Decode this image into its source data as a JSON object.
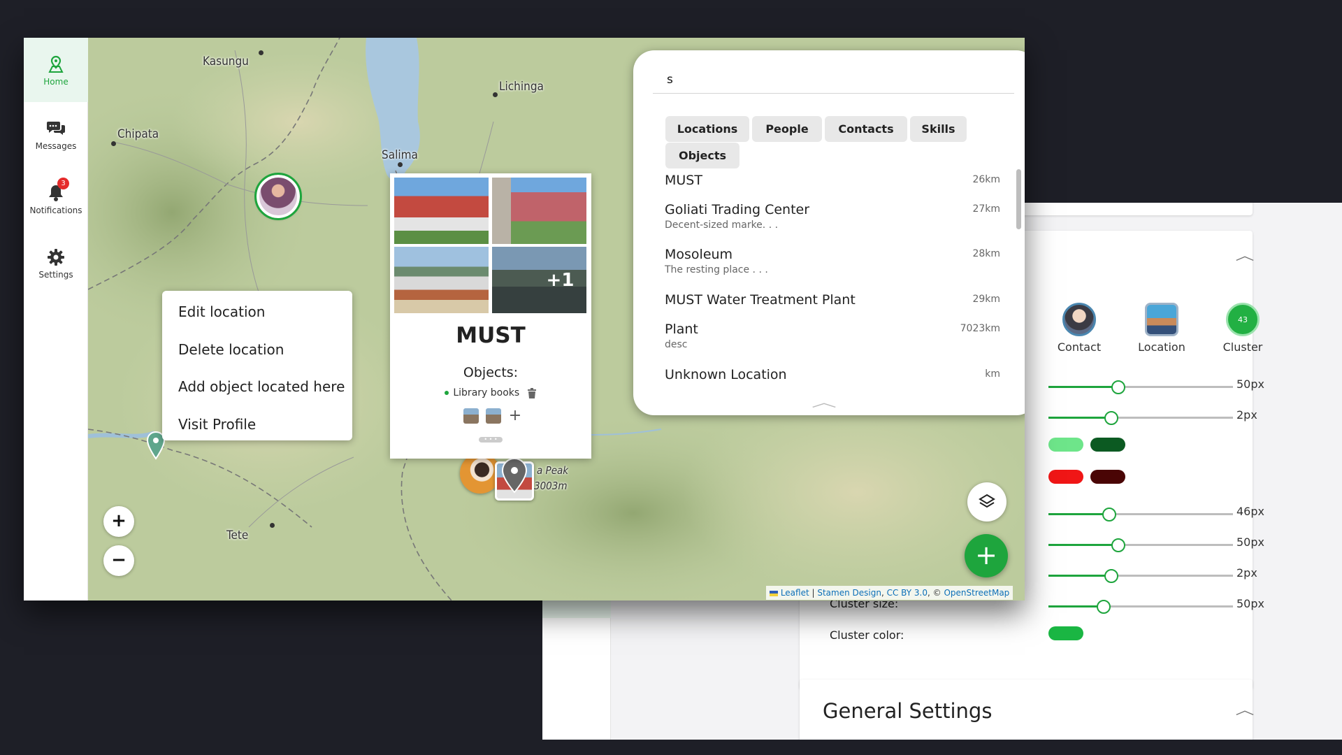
{
  "nav": {
    "home": "Home",
    "messages": "Messages",
    "notifications": "Notifications",
    "notifications_badge": "3",
    "settings": "Settings"
  },
  "map": {
    "places": {
      "kasungu": "Kasungu",
      "lichinga": "Lichinga",
      "chipata": "Chipata",
      "salima": "Salima",
      "tete": "Tete",
      "peak_line1": "a Peak",
      "peak_line2": "3003m"
    },
    "zoom_in": "+",
    "zoom_out": "−",
    "add_button": "+",
    "attribution": {
      "leaflet": "Leaflet",
      "sep1": " | ",
      "stamen": "Stamen Design",
      "sep2": ", ",
      "license": "CC BY 3.0",
      "sep3": ", © ",
      "osm": "OpenStreetMap"
    }
  },
  "context_menu": {
    "items": [
      "Edit location",
      "Delete location",
      "Add object located here",
      "Visit Profile"
    ]
  },
  "popup": {
    "extra_images": "+1",
    "title": "MUST",
    "objects_heading": "Objects:",
    "object_name": "Library books",
    "add_object": "+",
    "handle": "• • •"
  },
  "search": {
    "query": "s",
    "tabs": [
      "Locations",
      "People",
      "Contacts",
      "Skills",
      "Objects"
    ],
    "results": [
      {
        "name": "MUST",
        "desc": "",
        "distance": "26km"
      },
      {
        "name": "Goliati Trading Center",
        "desc": "Decent-sized marke. . .",
        "distance": "27km"
      },
      {
        "name": "Mosoleum",
        "desc": "The resting place . . .",
        "distance": "28km"
      },
      {
        "name": "MUST Water Treatment Plant",
        "desc": "",
        "distance": "29km"
      },
      {
        "name": "Plant",
        "desc": "desc",
        "distance": "7023km"
      },
      {
        "name": "Unknown Location",
        "desc": "",
        "distance": "km"
      }
    ],
    "collapse": "︿"
  },
  "settings": {
    "legend": {
      "contact": "Contact",
      "location": "Location",
      "cluster": "Cluster",
      "cluster_count": "43"
    },
    "sliders": [
      {
        "value_label": "50px",
        "fraction": 0.38
      },
      {
        "value_label": "2px",
        "fraction": 0.34
      },
      {
        "value_label": "46px",
        "fraction": 0.33
      },
      {
        "value_label": "50px",
        "fraction": 0.38
      },
      {
        "value_label": "2px",
        "fraction": 0.34
      },
      {
        "value_label": "50px",
        "fraction": 0.3
      }
    ],
    "cluster_size_label": "Cluster size:",
    "cluster_color_label": "Cluster color:",
    "general_settings_title": "General Settings",
    "colors": {
      "accent": "#1ea53d",
      "swatch_light_green": "#6ee58a",
      "swatch_dark_green": "#0c5a22",
      "swatch_red": "#f01616",
      "swatch_dark_red": "#4a0505",
      "cluster": "#1ab643"
    }
  }
}
